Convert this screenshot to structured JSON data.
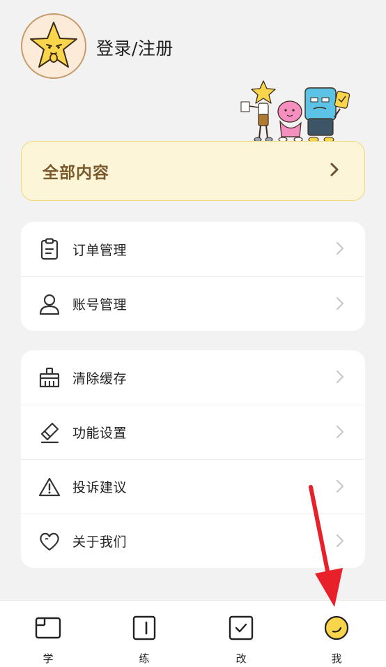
{
  "header": {
    "login_label": "登录/注册"
  },
  "all_content": {
    "label": "全部内容"
  },
  "group1": {
    "items": [
      {
        "label": "订单管理",
        "icon": "clipboard-icon"
      },
      {
        "label": "账号管理",
        "icon": "user-icon"
      }
    ]
  },
  "group2": {
    "items": [
      {
        "label": "清除缓存",
        "icon": "broom-icon"
      },
      {
        "label": "功能设置",
        "icon": "eraser-icon"
      },
      {
        "label": "投诉建议",
        "icon": "warning-icon"
      },
      {
        "label": "关于我们",
        "icon": "heart-icon"
      }
    ]
  },
  "tabbar": {
    "tabs": [
      {
        "label": "学",
        "icon": "book-icon"
      },
      {
        "label": "练",
        "icon": "practice-icon"
      },
      {
        "label": "改",
        "icon": "check-square-icon"
      },
      {
        "label": "我",
        "icon": "smiley-icon",
        "active": true
      }
    ]
  },
  "colors": {
    "background": "#f2f2f2",
    "accent_yellow": "#f8d54a",
    "card_yellow": "#fdf5d8",
    "card_border": "#f1d77a",
    "card_text": "#7a5a2c",
    "annotation_red": "#e8202a"
  }
}
